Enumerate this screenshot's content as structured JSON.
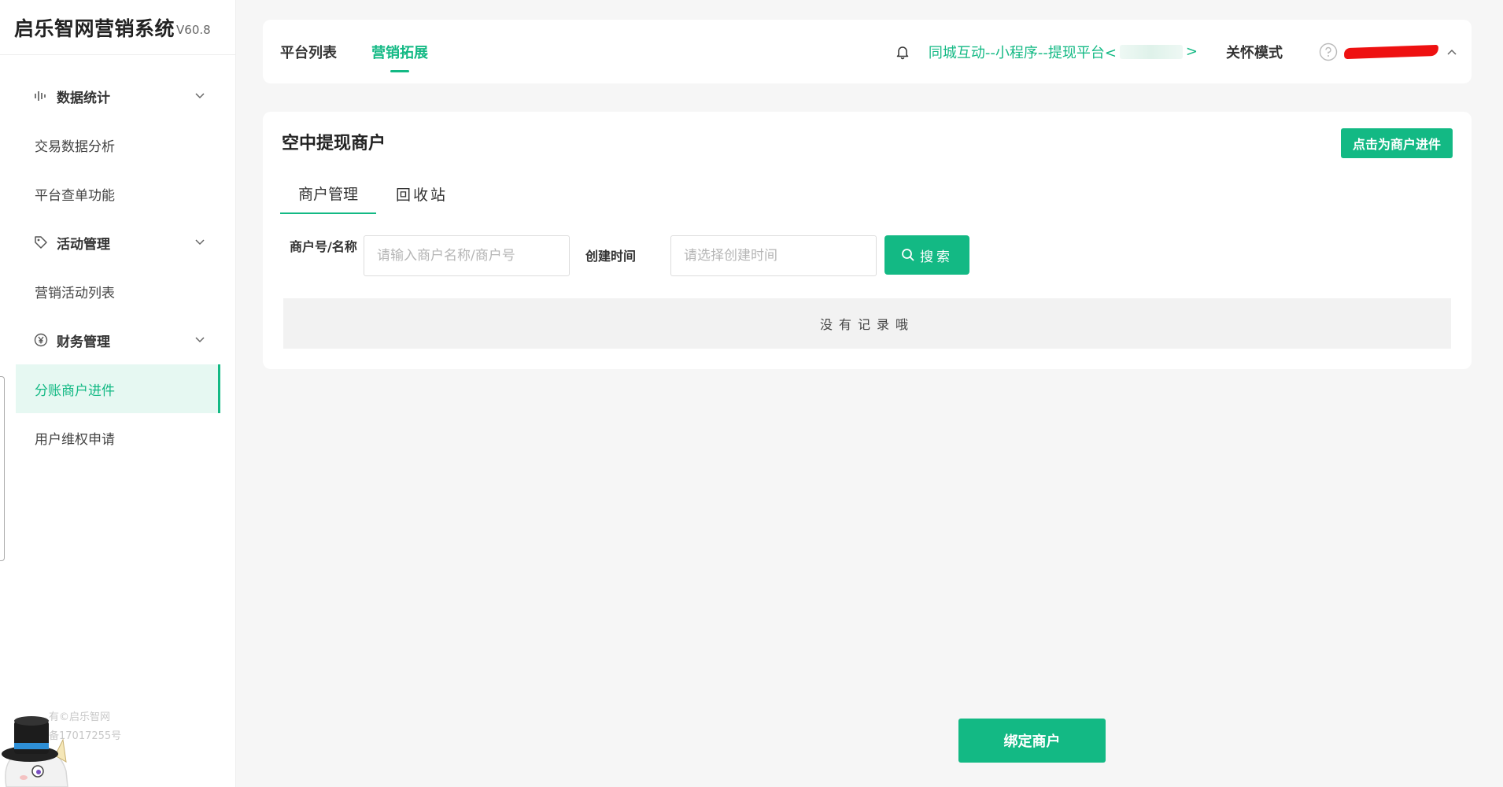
{
  "sidebar": {
    "brand_title": "启乐智网营销系统",
    "brand_version": "V60.8",
    "groups": [
      {
        "label": "数据统计",
        "icon": "bar-chart-icon",
        "items": [
          "交易数据分析",
          "平台查单功能"
        ]
      },
      {
        "label": "活动管理",
        "icon": "tag-icon",
        "items": [
          "营销活动列表"
        ]
      },
      {
        "label": "财务管理",
        "icon": "yen-icon",
        "items": [
          "分账商户进件",
          "用户维权申请"
        ]
      }
    ],
    "active_item": "分账商户进件",
    "copyright_line1": "有©启乐智网",
    "copyright_line2": "备17017255号"
  },
  "topbar": {
    "tabs": [
      "平台列表",
      "营销拓展"
    ],
    "active_tab": "营销拓展",
    "platform_prefix": "同城互动--小程序--提现平台<",
    "platform_suffix": ">",
    "care_mode": "关怀模式"
  },
  "main": {
    "title": "空中提现商户",
    "onboard_button": "点击为商户进件",
    "tabs": [
      "商户管理",
      "回收站"
    ],
    "active_tab": "商户管理",
    "filters": {
      "merchant_label": "商户号/名称",
      "merchant_placeholder": "请输入商户名称/商户号",
      "merchant_value": "",
      "time_label": "创建时间",
      "time_placeholder": "请选择创建时间",
      "time_value": ""
    },
    "search_button": "搜索",
    "empty_text": "没有记录哦",
    "bind_button": "绑定商户"
  },
  "colors": {
    "accent": "#13b984",
    "active_bg": "#e6f8f2",
    "page_bg": "#f6f6f6"
  }
}
